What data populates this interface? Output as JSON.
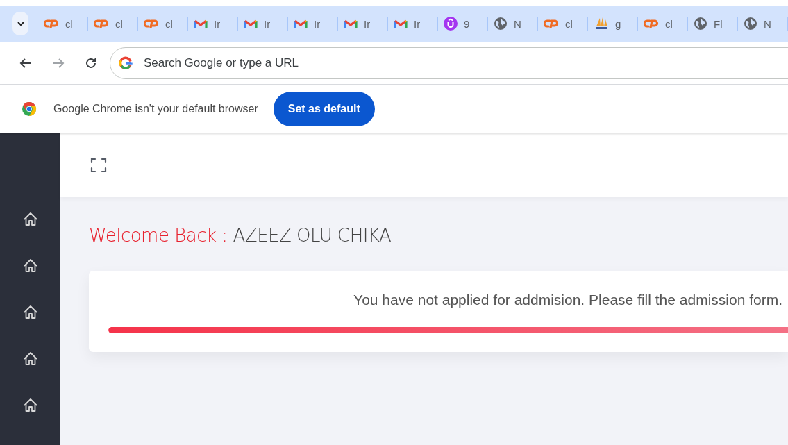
{
  "tabstrip": {
    "tabs": [
      {
        "kind": "cpanel",
        "title": "cl"
      },
      {
        "kind": "cpanel",
        "title": "cl"
      },
      {
        "kind": "cpanel",
        "title": "cl"
      },
      {
        "kind": "gmail",
        "title": "Ir"
      },
      {
        "kind": "gmail",
        "title": "Ir"
      },
      {
        "kind": "gmail",
        "title": "Ir"
      },
      {
        "kind": "gmail",
        "title": "Ir"
      },
      {
        "kind": "gmail",
        "title": "Ir"
      },
      {
        "kind": "badge",
        "title": "9"
      },
      {
        "kind": "globe",
        "title": "N"
      },
      {
        "kind": "cpanel",
        "title": "cl"
      },
      {
        "kind": "sails",
        "title": "g"
      },
      {
        "kind": "cpanel",
        "title": "cl"
      },
      {
        "kind": "globe",
        "title": "Fl"
      },
      {
        "kind": "globe",
        "title": "N"
      }
    ]
  },
  "toolbar": {
    "omnibox": {
      "placeholder": "Search Google or type a URL"
    }
  },
  "infobar": {
    "message": "Google Chrome isn't your default browser",
    "button": "Set as default"
  },
  "sidebar": {
    "items": [
      {
        "kind": "home"
      },
      {
        "kind": "home"
      },
      {
        "kind": "home"
      },
      {
        "kind": "home"
      },
      {
        "kind": "home"
      }
    ]
  },
  "welcome": {
    "label": "Welcome Back :",
    "name": "AZEEZ OLU CHIKA"
  },
  "notice": {
    "message": "You have not applied for addmision. Please fill the admission form.",
    "progress": {
      "level": 1
    }
  }
}
